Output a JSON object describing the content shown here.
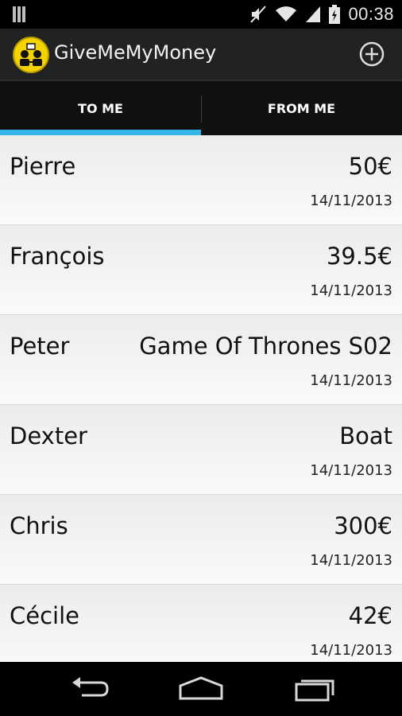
{
  "status_bar": {
    "time": "00:38"
  },
  "app": {
    "title": "GiveMeMyMoney"
  },
  "tabs": [
    {
      "label": "TO ME",
      "selected": true
    },
    {
      "label": "FROM ME",
      "selected": false
    }
  ],
  "entries": [
    {
      "name": "Pierre",
      "amount": "50€",
      "date": "14/11/2013"
    },
    {
      "name": "François",
      "amount": "39.5€",
      "date": "14/11/2013"
    },
    {
      "name": "Peter",
      "amount": "Game Of Thrones S02",
      "date": "14/11/2013"
    },
    {
      "name": "Dexter",
      "amount": "Boat",
      "date": "14/11/2013"
    },
    {
      "name": "Chris",
      "amount": "300€",
      "date": "14/11/2013"
    },
    {
      "name": "Cécile",
      "amount": "42€",
      "date": "14/11/2013"
    }
  ],
  "colors": {
    "accent": "#33b5e5",
    "app_icon_bg": "#f5d300"
  },
  "icons": [
    "signal-icon",
    "mute-icon",
    "wifi-icon",
    "battery-icon",
    "add-icon",
    "back-icon",
    "home-icon",
    "recents-icon"
  ]
}
